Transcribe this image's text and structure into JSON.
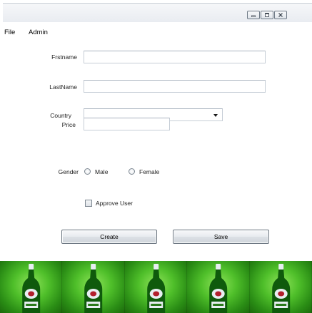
{
  "window": {
    "controls": [
      {
        "name": "minimize",
        "icon": "minimize-icon"
      },
      {
        "name": "maximize",
        "icon": "maximize-icon"
      },
      {
        "name": "close",
        "icon": "close-icon"
      }
    ]
  },
  "menu": {
    "items": [
      "File",
      "Admin"
    ]
  },
  "form": {
    "firstname_label": "Frstname",
    "firstname_value": "",
    "lastname_label": "LastName",
    "lastname_value": "",
    "country_label": "Country",
    "country_value": "",
    "price_label": "Price",
    "price_value": "",
    "gender_label": "Gender",
    "gender_options": [
      "Male",
      "Female"
    ],
    "approve_label": "Approve User",
    "approve_checked": false
  },
  "actions": {
    "create_label": "Create",
    "save_label": "Save"
  },
  "banner": {
    "icon": "beer-bottle-icon",
    "tile_count": 5,
    "colors": {
      "bg": "#2f8f1a",
      "bottle": "#0f5a0c",
      "label": "#e8eef2"
    }
  }
}
